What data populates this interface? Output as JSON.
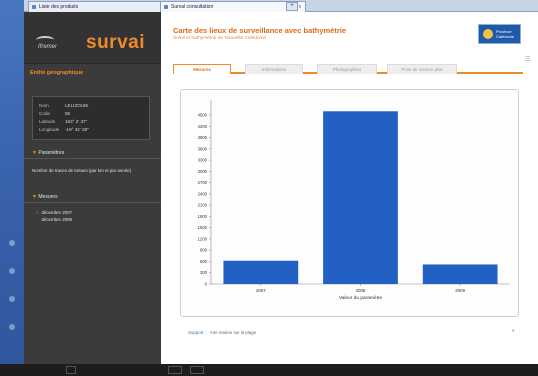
{
  "browser": {
    "tabs": [
      {
        "label": "Liste des produits",
        "close": "x"
      },
      {
        "label": "Surval consultation",
        "close": "x"
      }
    ],
    "new_tab": "+"
  },
  "sidebar": {
    "brand_small": "Ifremer",
    "brand": "survai",
    "section_title": "Entité géographique",
    "info": [
      {
        "k": "Nom",
        "v": "LELIZOUIE"
      },
      {
        "k": "Code",
        "v": "55"
      },
      {
        "k": "Latitude",
        "v": "163° 2' 37\""
      },
      {
        "k": "Longitude",
        "v": "-19° 42' 38\""
      }
    ],
    "parametres_label": "Paramètres",
    "param_text": "Nombre de traces de tortues (par km et par année)",
    "mesures_label": "Mesures",
    "dates": [
      "décembre 2007",
      "décembre 2008"
    ]
  },
  "main": {
    "title": "Carte des lieux de surveillance avec bathymétrie",
    "subtitle": "Soleil et bathymétrie de Nouvelle Calédonie",
    "logo_text": [
      "Province",
      "Calédonie"
    ],
    "tabs": [
      {
        "label": "Mesures",
        "active": true
      },
      {
        "label": "Informations",
        "active": false
      },
      {
        "label": "Photographies",
        "active": false
      },
      {
        "label": "Point de mesure plus",
        "active": false
      }
    ],
    "footnote_label": "Support :",
    "footnote_text": "Aire marine sur la plage"
  },
  "chart_data": {
    "type": "bar",
    "categories": [
      "2007",
      "2008",
      "2009"
    ],
    "values": [
      620,
      4600,
      520
    ],
    "xlabel": "Valeur du paramètre",
    "ylabel": "",
    "ylim": [
      0,
      4900
    ],
    "yticks": [
      0,
      300,
      600,
      900,
      1200,
      1500,
      1800,
      2100,
      2400,
      2700,
      3000,
      3300,
      3600,
      3900,
      4200,
      4500
    ],
    "bar_color": "#2360c4",
    "grid": false
  },
  "colors": {
    "accent": "#f08a2a",
    "sidebar": "#3b3b3b",
    "bar": "#2360c4"
  }
}
